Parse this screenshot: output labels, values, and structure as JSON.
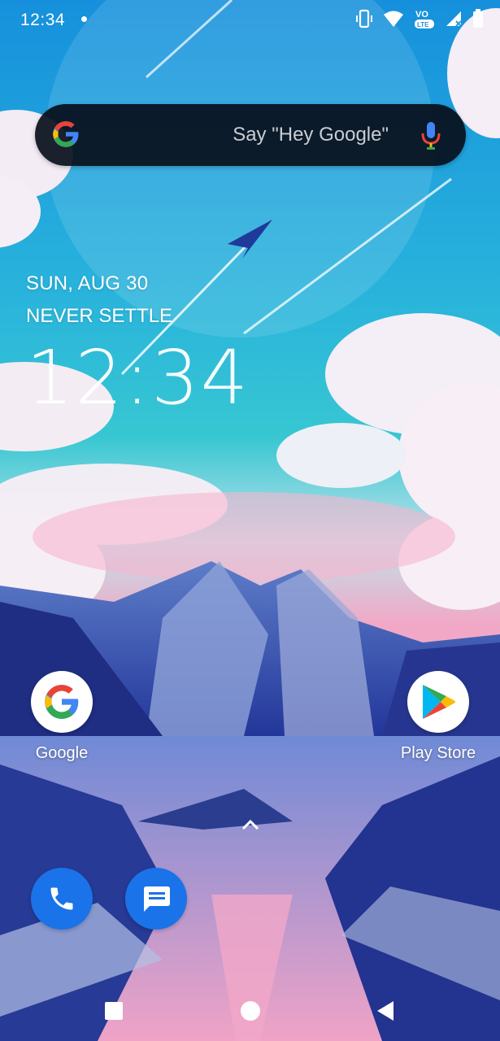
{
  "status_bar": {
    "time": "12:34",
    "lte_label": "LTE",
    "volte_label": "VO",
    "icons": [
      "notification-dot",
      "vibrate-icon",
      "wifi-icon",
      "volte-icon",
      "signal-icon",
      "battery-icon"
    ]
  },
  "search": {
    "placeholder": "Say \"Hey Google\"",
    "logo": "google-g-icon",
    "mic": "mic-icon"
  },
  "at_a_glance": {
    "date": "SUN, AUG 30",
    "event": "NEVER SETTLE",
    "clock": "12:34"
  },
  "home_apps": [
    {
      "label": "Google",
      "icon": "google-icon"
    },
    {
      "label": "Play Store",
      "icon": "play-store-icon"
    }
  ],
  "dock": [
    {
      "name": "Phone",
      "icon": "phone-icon"
    },
    {
      "name": "Messages",
      "icon": "messages-icon"
    }
  ],
  "nav": [
    "recents-button",
    "home-button",
    "back-button"
  ],
  "colors": {
    "sky_top": "#1d9be0",
    "sky_mid": "#2fc2d6",
    "horizon_pink": "#f2a9c8",
    "mountain_navy": "#1c2f86",
    "dock_blue": "#1a73e8",
    "search_bg": "#080e1a"
  }
}
